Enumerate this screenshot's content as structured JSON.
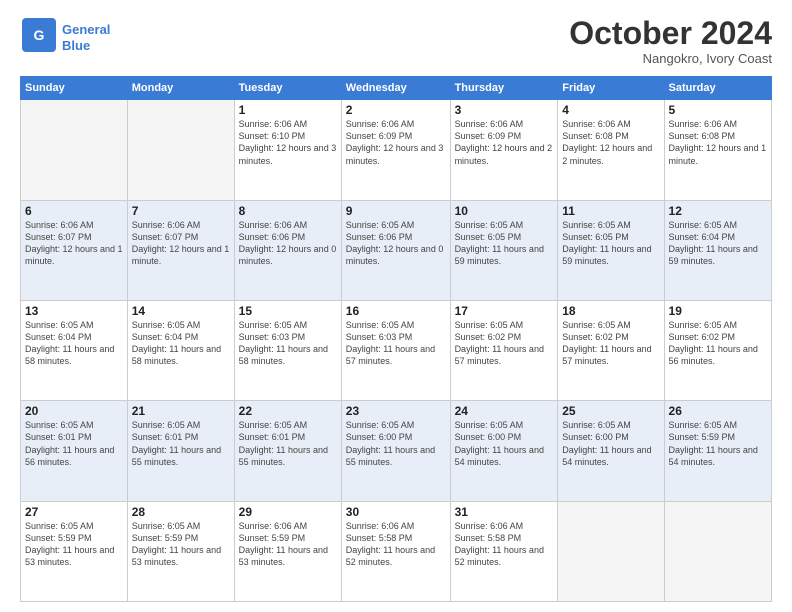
{
  "logo": {
    "line1": "General",
    "line2": "Blue"
  },
  "title": "October 2024",
  "subtitle": "Nangokro, Ivory Coast",
  "weekdays": [
    "Sunday",
    "Monday",
    "Tuesday",
    "Wednesday",
    "Thursday",
    "Friday",
    "Saturday"
  ],
  "weeks": [
    [
      {
        "day": "",
        "info": ""
      },
      {
        "day": "",
        "info": ""
      },
      {
        "day": "1",
        "info": "Sunrise: 6:06 AM\nSunset: 6:10 PM\nDaylight: 12 hours\nand 3 minutes."
      },
      {
        "day": "2",
        "info": "Sunrise: 6:06 AM\nSunset: 6:09 PM\nDaylight: 12 hours\nand 3 minutes."
      },
      {
        "day": "3",
        "info": "Sunrise: 6:06 AM\nSunset: 6:09 PM\nDaylight: 12 hours\nand 2 minutes."
      },
      {
        "day": "4",
        "info": "Sunrise: 6:06 AM\nSunset: 6:08 PM\nDaylight: 12 hours\nand 2 minutes."
      },
      {
        "day": "5",
        "info": "Sunrise: 6:06 AM\nSunset: 6:08 PM\nDaylight: 12 hours\nand 1 minute."
      }
    ],
    [
      {
        "day": "6",
        "info": "Sunrise: 6:06 AM\nSunset: 6:07 PM\nDaylight: 12 hours\nand 1 minute."
      },
      {
        "day": "7",
        "info": "Sunrise: 6:06 AM\nSunset: 6:07 PM\nDaylight: 12 hours\nand 1 minute."
      },
      {
        "day": "8",
        "info": "Sunrise: 6:06 AM\nSunset: 6:06 PM\nDaylight: 12 hours\nand 0 minutes."
      },
      {
        "day": "9",
        "info": "Sunrise: 6:05 AM\nSunset: 6:06 PM\nDaylight: 12 hours\nand 0 minutes."
      },
      {
        "day": "10",
        "info": "Sunrise: 6:05 AM\nSunset: 6:05 PM\nDaylight: 11 hours\nand 59 minutes."
      },
      {
        "day": "11",
        "info": "Sunrise: 6:05 AM\nSunset: 6:05 PM\nDaylight: 11 hours\nand 59 minutes."
      },
      {
        "day": "12",
        "info": "Sunrise: 6:05 AM\nSunset: 6:04 PM\nDaylight: 11 hours\nand 59 minutes."
      }
    ],
    [
      {
        "day": "13",
        "info": "Sunrise: 6:05 AM\nSunset: 6:04 PM\nDaylight: 11 hours\nand 58 minutes."
      },
      {
        "day": "14",
        "info": "Sunrise: 6:05 AM\nSunset: 6:04 PM\nDaylight: 11 hours\nand 58 minutes."
      },
      {
        "day": "15",
        "info": "Sunrise: 6:05 AM\nSunset: 6:03 PM\nDaylight: 11 hours\nand 58 minutes."
      },
      {
        "day": "16",
        "info": "Sunrise: 6:05 AM\nSunset: 6:03 PM\nDaylight: 11 hours\nand 57 minutes."
      },
      {
        "day": "17",
        "info": "Sunrise: 6:05 AM\nSunset: 6:02 PM\nDaylight: 11 hours\nand 57 minutes."
      },
      {
        "day": "18",
        "info": "Sunrise: 6:05 AM\nSunset: 6:02 PM\nDaylight: 11 hours\nand 57 minutes."
      },
      {
        "day": "19",
        "info": "Sunrise: 6:05 AM\nSunset: 6:02 PM\nDaylight: 11 hours\nand 56 minutes."
      }
    ],
    [
      {
        "day": "20",
        "info": "Sunrise: 6:05 AM\nSunset: 6:01 PM\nDaylight: 11 hours\nand 56 minutes."
      },
      {
        "day": "21",
        "info": "Sunrise: 6:05 AM\nSunset: 6:01 PM\nDaylight: 11 hours\nand 55 minutes."
      },
      {
        "day": "22",
        "info": "Sunrise: 6:05 AM\nSunset: 6:01 PM\nDaylight: 11 hours\nand 55 minutes."
      },
      {
        "day": "23",
        "info": "Sunrise: 6:05 AM\nSunset: 6:00 PM\nDaylight: 11 hours\nand 55 minutes."
      },
      {
        "day": "24",
        "info": "Sunrise: 6:05 AM\nSunset: 6:00 PM\nDaylight: 11 hours\nand 54 minutes."
      },
      {
        "day": "25",
        "info": "Sunrise: 6:05 AM\nSunset: 6:00 PM\nDaylight: 11 hours\nand 54 minutes."
      },
      {
        "day": "26",
        "info": "Sunrise: 6:05 AM\nSunset: 5:59 PM\nDaylight: 11 hours\nand 54 minutes."
      }
    ],
    [
      {
        "day": "27",
        "info": "Sunrise: 6:05 AM\nSunset: 5:59 PM\nDaylight: 11 hours\nand 53 minutes."
      },
      {
        "day": "28",
        "info": "Sunrise: 6:05 AM\nSunset: 5:59 PM\nDaylight: 11 hours\nand 53 minutes."
      },
      {
        "day": "29",
        "info": "Sunrise: 6:06 AM\nSunset: 5:59 PM\nDaylight: 11 hours\nand 53 minutes."
      },
      {
        "day": "30",
        "info": "Sunrise: 6:06 AM\nSunset: 5:58 PM\nDaylight: 11 hours\nand 52 minutes."
      },
      {
        "day": "31",
        "info": "Sunrise: 6:06 AM\nSunset: 5:58 PM\nDaylight: 11 hours\nand 52 minutes."
      },
      {
        "day": "",
        "info": ""
      },
      {
        "day": "",
        "info": ""
      }
    ]
  ]
}
